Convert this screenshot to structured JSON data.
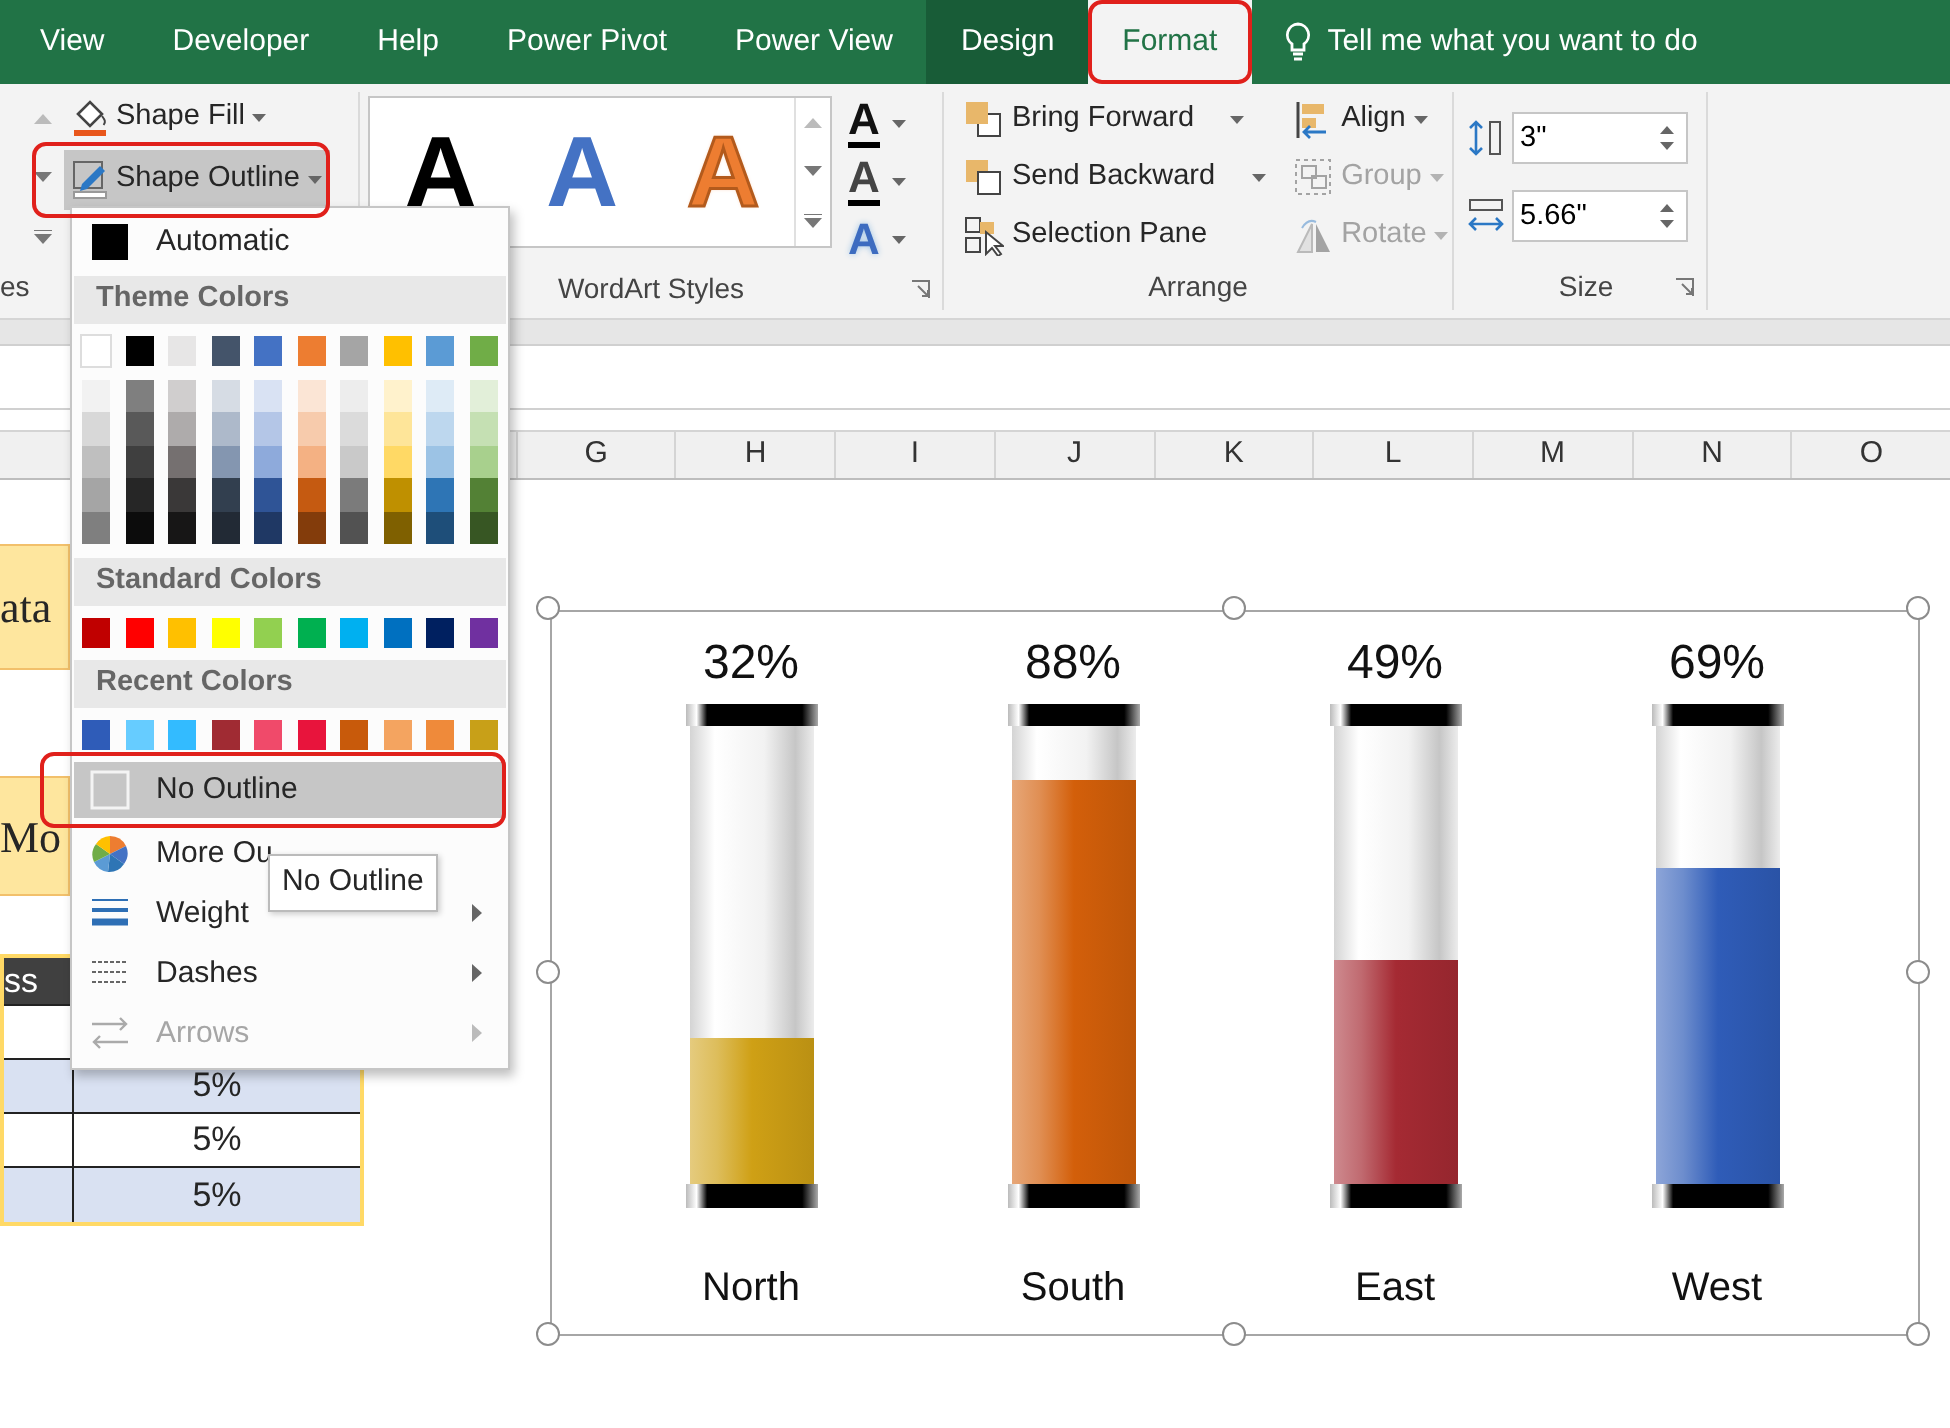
{
  "tabs": [
    {
      "label": "View",
      "selected": false,
      "contextual": false,
      "highlighted": false
    },
    {
      "label": "Developer",
      "selected": false,
      "contextual": false,
      "highlighted": false
    },
    {
      "label": "Help",
      "selected": false,
      "contextual": false,
      "highlighted": false
    },
    {
      "label": "Power Pivot",
      "selected": false,
      "contextual": false,
      "highlighted": false
    },
    {
      "label": "Power View",
      "selected": false,
      "contextual": false,
      "highlighted": false
    },
    {
      "label": "Design",
      "selected": false,
      "contextual": true,
      "highlighted": false
    },
    {
      "label": "Format",
      "selected": true,
      "contextual": true,
      "highlighted": true
    }
  ],
  "tell_me": "Tell me what you want to do",
  "ribbon": {
    "shape_styles": {
      "label": "es",
      "fill_button": "Shape Fill",
      "outline_button": {
        "label": "Shape Outline",
        "open": true,
        "highlighted": true
      }
    },
    "wordart": {
      "label": "WordArt Styles",
      "samples": [
        {
          "text": "A",
          "color": "#000000",
          "kind": "filled"
        },
        {
          "text": "A",
          "color": "#4472c4",
          "kind": "filled"
        },
        {
          "text": "A",
          "color": "#ed7d31",
          "kind": "outlined"
        }
      ],
      "tools": [
        {
          "kind": "fill",
          "glyph": "A"
        },
        {
          "kind": "outline",
          "glyph": "A"
        },
        {
          "kind": "effects",
          "glyph": "A"
        }
      ]
    },
    "arrange": {
      "label": "Arrange",
      "items": [
        {
          "kind": "bring-forward",
          "label": "Bring Forward",
          "dropdown": true,
          "disabled": false
        },
        {
          "kind": "send-backward",
          "label": "Send Backward",
          "dropdown": true,
          "disabled": false
        },
        {
          "kind": "selection-pane",
          "label": "Selection Pane",
          "dropdown": false,
          "disabled": false
        },
        {
          "kind": "align",
          "label": "Align",
          "dropdown": true,
          "disabled": false
        },
        {
          "kind": "group",
          "label": "Group",
          "dropdown": true,
          "disabled": true
        },
        {
          "kind": "rotate",
          "label": "Rotate",
          "dropdown": true,
          "disabled": true
        }
      ]
    },
    "size": {
      "label": "Size",
      "fields": [
        {
          "kind": "height",
          "value": "3\""
        },
        {
          "kind": "width",
          "value": "5.66\""
        }
      ]
    }
  },
  "menu": {
    "automatic": "Automatic",
    "theme_heading": "Theme Colors",
    "theme_colors": [
      [
        {
          "color": "#ffffff"
        },
        {
          "color": "#000000"
        },
        {
          "color": "#e7e6e6"
        },
        {
          "color": "#44546a"
        },
        {
          "color": "#4472c4"
        },
        {
          "color": "#ed7d31"
        },
        {
          "color": "#a5a5a5"
        },
        {
          "color": "#ffc000"
        },
        {
          "color": "#5b9bd5"
        },
        {
          "color": "#70ad47"
        }
      ],
      [
        {
          "color": "#f2f2f2"
        },
        {
          "color": "#7f7f7f"
        },
        {
          "color": "#d0cece"
        },
        {
          "color": "#d6dce4"
        },
        {
          "color": "#d9e2f3"
        },
        {
          "color": "#fbe5d5"
        },
        {
          "color": "#ededed"
        },
        {
          "color": "#fff2cc"
        },
        {
          "color": "#deebf6"
        },
        {
          "color": "#e2efd9"
        }
      ],
      [
        {
          "color": "#d8d8d8"
        },
        {
          "color": "#595959"
        },
        {
          "color": "#aeabab"
        },
        {
          "color": "#adb9ca"
        },
        {
          "color": "#b4c6e7"
        },
        {
          "color": "#f7cbac"
        },
        {
          "color": "#dbdbdb"
        },
        {
          "color": "#fee599"
        },
        {
          "color": "#bdd7ee"
        },
        {
          "color": "#c5e0b3"
        }
      ],
      [
        {
          "color": "#bfbfbf"
        },
        {
          "color": "#3f3f3f"
        },
        {
          "color": "#757070"
        },
        {
          "color": "#8496b0"
        },
        {
          "color": "#8eaadb"
        },
        {
          "color": "#f4b183"
        },
        {
          "color": "#c9c9c9"
        },
        {
          "color": "#ffd965"
        },
        {
          "color": "#9cc3e5"
        },
        {
          "color": "#a8d08d"
        }
      ],
      [
        {
          "color": "#a5a5a5"
        },
        {
          "color": "#262626"
        },
        {
          "color": "#3a3838"
        },
        {
          "color": "#323f4f"
        },
        {
          "color": "#2f5496"
        },
        {
          "color": "#c55a11"
        },
        {
          "color": "#7b7b7b"
        },
        {
          "color": "#bf9000"
        },
        {
          "color": "#2e75b5"
        },
        {
          "color": "#538135"
        }
      ],
      [
        {
          "color": "#7f7f7f"
        },
        {
          "color": "#0c0c0c"
        },
        {
          "color": "#171616"
        },
        {
          "color": "#222a35"
        },
        {
          "color": "#1f3864"
        },
        {
          "color": "#833c0b"
        },
        {
          "color": "#525252"
        },
        {
          "color": "#7f6000"
        },
        {
          "color": "#1e4e79"
        },
        {
          "color": "#375623"
        }
      ]
    ],
    "standard_heading": "Standard Colors",
    "standard_colors": [
      {
        "color": "#c00000"
      },
      {
        "color": "#ff0000"
      },
      {
        "color": "#ffc000"
      },
      {
        "color": "#ffff00"
      },
      {
        "color": "#92d050"
      },
      {
        "color": "#00b050"
      },
      {
        "color": "#00b0f0"
      },
      {
        "color": "#0070c0"
      },
      {
        "color": "#002060"
      },
      {
        "color": "#7030a0"
      }
    ],
    "recent_heading": "Recent Colors",
    "recent_colors": [
      {
        "color": "#2f5cb8"
      },
      {
        "color": "#66ccff"
      },
      {
        "color": "#33bbff"
      },
      {
        "color": "#a02b33"
      },
      {
        "color": "#f04a6a"
      },
      {
        "color": "#e8143c"
      },
      {
        "color": "#c85a0b"
      },
      {
        "color": "#f4a460"
      },
      {
        "color": "#ef8a3a"
      },
      {
        "color": "#c8a018"
      }
    ],
    "items": [
      {
        "kind": "no-outline",
        "label": "No Outline",
        "hovered": true,
        "highlighted": true,
        "disabled": false,
        "submenu": false
      },
      {
        "kind": "more-colors",
        "label": "More Ou",
        "hovered": false,
        "highlighted": false,
        "disabled": false,
        "submenu": false
      },
      {
        "kind": "weight",
        "label": "Weight",
        "hovered": false,
        "highlighted": false,
        "disabled": false,
        "submenu": true
      },
      {
        "kind": "dashes",
        "label": "Dashes",
        "hovered": false,
        "highlighted": false,
        "disabled": false,
        "submenu": true
      },
      {
        "kind": "arrows",
        "label": "Arrows",
        "hovered": false,
        "highlighted": false,
        "disabled": true,
        "submenu": true
      }
    ]
  },
  "tooltip": "No Outline",
  "columns": [
    "G",
    "H",
    "I",
    "J",
    "K",
    "L",
    "M",
    "N",
    "O"
  ],
  "sheet": {
    "cells": [
      {
        "kind": "title",
        "text": "ata"
      },
      {
        "kind": "title",
        "text": "Mo"
      }
    ],
    "table": {
      "header": "ss",
      "rows": [
        {
          "banded": false
        },
        {
          "banded": true,
          "value": "5%"
        },
        {
          "banded": false,
          "value": "5%"
        },
        {
          "banded": true,
          "value": "5%"
        }
      ]
    }
  },
  "chart": {
    "selected": true,
    "gauges": [
      {
        "category": "North",
        "reading": "32%",
        "level": 0.32,
        "color": "#cfa015"
      },
      {
        "category": "South",
        "reading": "88%",
        "level": 0.88,
        "color": "#d35f0a"
      },
      {
        "category": "East",
        "reading": "49%",
        "level": 0.49,
        "color": "#a52a33"
      },
      {
        "category": "West",
        "reading": "69%",
        "level": 0.69,
        "color": "#2f5cb8"
      }
    ]
  }
}
